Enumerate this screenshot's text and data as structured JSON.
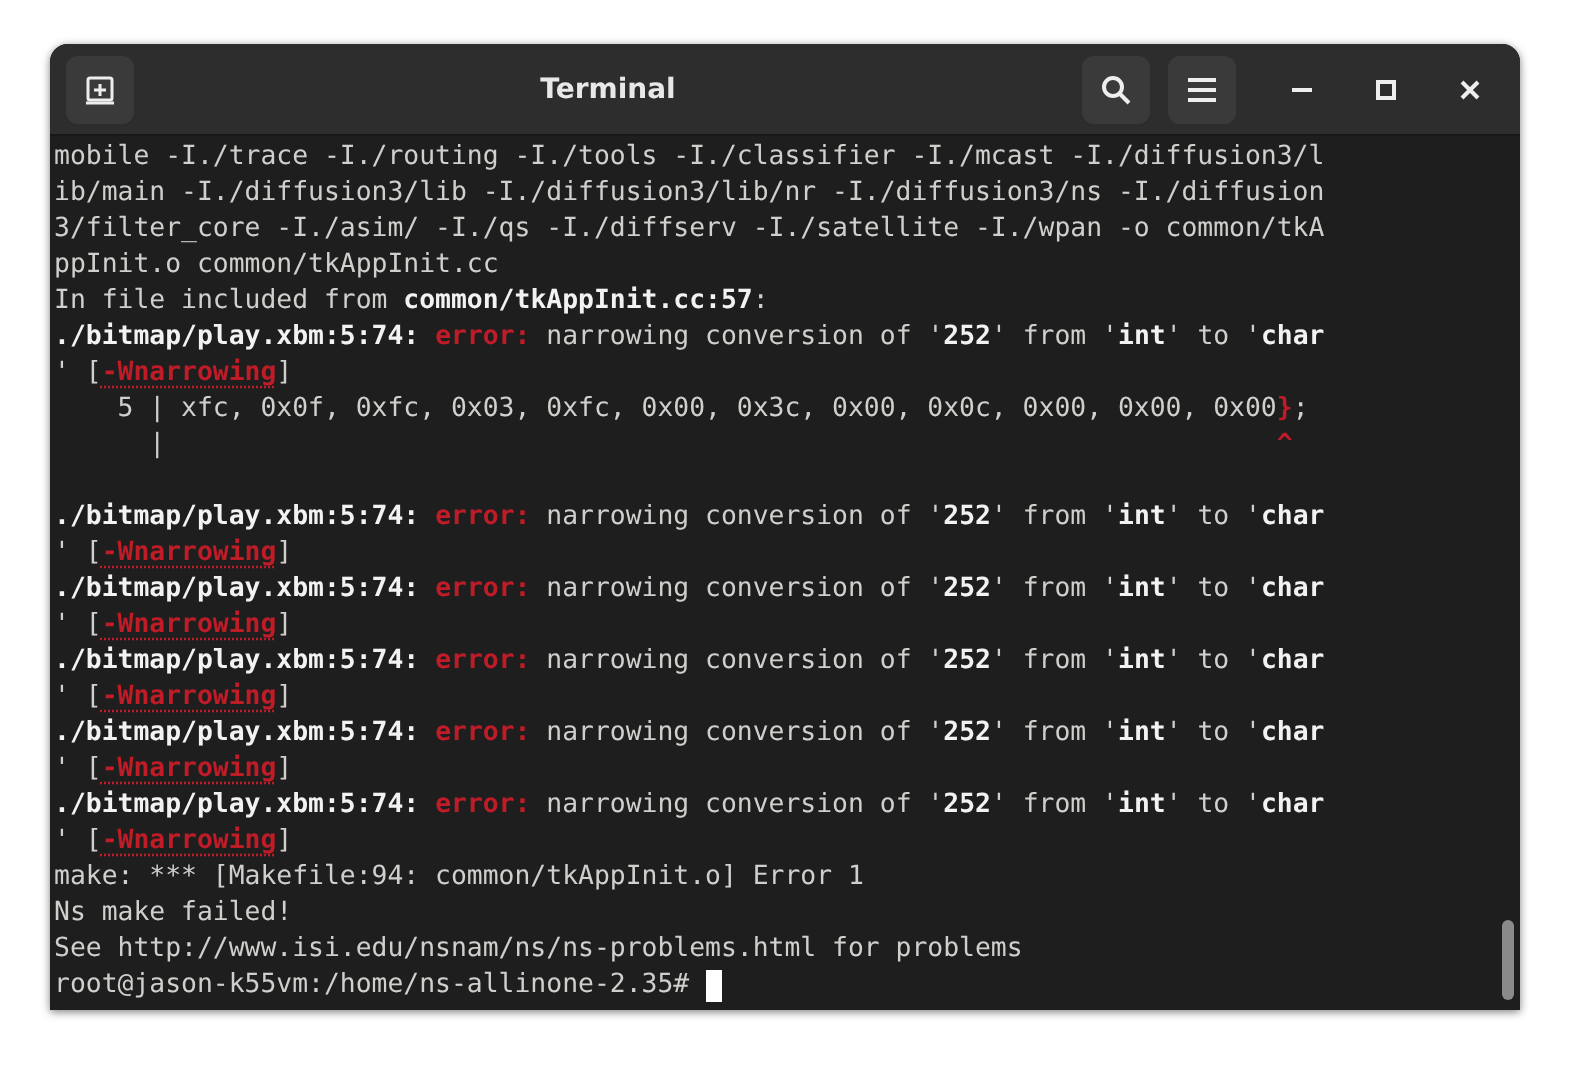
{
  "window": {
    "title": "Terminal"
  },
  "terminal": {
    "cursor": true,
    "lines": [
      {
        "kind": "text",
        "segments": [
          {
            "kind": "plain",
            "text": "mobile -I./trace -I./routing -I./tools -I./classifier -I./mcast -I./diffusion3/l"
          }
        ]
      },
      {
        "kind": "text",
        "segments": [
          {
            "kind": "plain",
            "text": "ib/main -I./diffusion3/lib -I./diffusion3/lib/nr -I./diffusion3/ns -I./diffusion"
          }
        ]
      },
      {
        "kind": "text",
        "segments": [
          {
            "kind": "plain",
            "text": "3/filter_core -I./asim/ -I./qs -I./diffserv -I./satellite -I./wpan -o common/tkA"
          }
        ]
      },
      {
        "kind": "text",
        "segments": [
          {
            "kind": "plain",
            "text": "ppInit.o common/tkAppInit.cc"
          }
        ]
      },
      {
        "kind": "text",
        "segments": [
          {
            "kind": "plain",
            "text": "In file included from "
          },
          {
            "kind": "bold",
            "text": "common/tkAppInit.cc:57"
          },
          {
            "kind": "plain",
            "text": ":"
          }
        ]
      },
      {
        "kind": "text",
        "segments": [
          {
            "kind": "bold",
            "text": "./bitmap/play.xbm:5:74:"
          },
          {
            "kind": "error",
            "text": " error:"
          },
          {
            "kind": "plain",
            "text": " narrowing conversion of '"
          },
          {
            "kind": "bold",
            "text": "252"
          },
          {
            "kind": "plain",
            "text": "' from '"
          },
          {
            "kind": "bold",
            "text": "int"
          },
          {
            "kind": "plain",
            "text": "' to '"
          },
          {
            "kind": "bold",
            "text": "char"
          }
        ]
      },
      {
        "kind": "text",
        "segments": [
          {
            "kind": "plain",
            "text": "' ["
          },
          {
            "kind": "flag",
            "text": "-Wnarrowing"
          },
          {
            "kind": "plain",
            "text": "]"
          }
        ]
      },
      {
        "kind": "text",
        "segments": [
          {
            "kind": "plain",
            "text": "    5 | xfc, 0x0f, 0xfc, 0x03, 0xfc, 0x00, 0x3c, 0x00, 0x0c, 0x00, 0x00, 0x00"
          },
          {
            "kind": "mark",
            "text": "}"
          },
          {
            "kind": "plain",
            "text": ";"
          }
        ]
      },
      {
        "kind": "text",
        "segments": [
          {
            "kind": "plain",
            "text": "      |                                                                      "
          },
          {
            "kind": "mark",
            "text": "^"
          }
        ]
      },
      {
        "kind": "blank"
      },
      {
        "kind": "text",
        "segments": [
          {
            "kind": "bold",
            "text": "./bitmap/play.xbm:5:74:"
          },
          {
            "kind": "error",
            "text": " error:"
          },
          {
            "kind": "plain",
            "text": " narrowing conversion of '"
          },
          {
            "kind": "bold",
            "text": "252"
          },
          {
            "kind": "plain",
            "text": "' from '"
          },
          {
            "kind": "bold",
            "text": "int"
          },
          {
            "kind": "plain",
            "text": "' to '"
          },
          {
            "kind": "bold",
            "text": "char"
          }
        ]
      },
      {
        "kind": "text",
        "segments": [
          {
            "kind": "plain",
            "text": "' ["
          },
          {
            "kind": "flag",
            "text": "-Wnarrowing"
          },
          {
            "kind": "plain",
            "text": "]"
          }
        ]
      },
      {
        "kind": "text",
        "segments": [
          {
            "kind": "bold",
            "text": "./bitmap/play.xbm:5:74:"
          },
          {
            "kind": "error",
            "text": " error:"
          },
          {
            "kind": "plain",
            "text": " narrowing conversion of '"
          },
          {
            "kind": "bold",
            "text": "252"
          },
          {
            "kind": "plain",
            "text": "' from '"
          },
          {
            "kind": "bold",
            "text": "int"
          },
          {
            "kind": "plain",
            "text": "' to '"
          },
          {
            "kind": "bold",
            "text": "char"
          }
        ]
      },
      {
        "kind": "text",
        "segments": [
          {
            "kind": "plain",
            "text": "' ["
          },
          {
            "kind": "flag",
            "text": "-Wnarrowing"
          },
          {
            "kind": "plain",
            "text": "]"
          }
        ]
      },
      {
        "kind": "text",
        "segments": [
          {
            "kind": "bold",
            "text": "./bitmap/play.xbm:5:74:"
          },
          {
            "kind": "error",
            "text": " error:"
          },
          {
            "kind": "plain",
            "text": " narrowing conversion of '"
          },
          {
            "kind": "bold",
            "text": "252"
          },
          {
            "kind": "plain",
            "text": "' from '"
          },
          {
            "kind": "bold",
            "text": "int"
          },
          {
            "kind": "plain",
            "text": "' to '"
          },
          {
            "kind": "bold",
            "text": "char"
          }
        ]
      },
      {
        "kind": "text",
        "segments": [
          {
            "kind": "plain",
            "text": "' ["
          },
          {
            "kind": "flag",
            "text": "-Wnarrowing"
          },
          {
            "kind": "plain",
            "text": "]"
          }
        ]
      },
      {
        "kind": "text",
        "segments": [
          {
            "kind": "bold",
            "text": "./bitmap/play.xbm:5:74:"
          },
          {
            "kind": "error",
            "text": " error:"
          },
          {
            "kind": "plain",
            "text": " narrowing conversion of '"
          },
          {
            "kind": "bold",
            "text": "252"
          },
          {
            "kind": "plain",
            "text": "' from '"
          },
          {
            "kind": "bold",
            "text": "int"
          },
          {
            "kind": "plain",
            "text": "' to '"
          },
          {
            "kind": "bold",
            "text": "char"
          }
        ]
      },
      {
        "kind": "text",
        "segments": [
          {
            "kind": "plain",
            "text": "' ["
          },
          {
            "kind": "flag",
            "text": "-Wnarrowing"
          },
          {
            "kind": "plain",
            "text": "]"
          }
        ]
      },
      {
        "kind": "text",
        "segments": [
          {
            "kind": "bold",
            "text": "./bitmap/play.xbm:5:74:"
          },
          {
            "kind": "error",
            "text": " error:"
          },
          {
            "kind": "plain",
            "text": " narrowing conversion of '"
          },
          {
            "kind": "bold",
            "text": "252"
          },
          {
            "kind": "plain",
            "text": "' from '"
          },
          {
            "kind": "bold",
            "text": "int"
          },
          {
            "kind": "plain",
            "text": "' to '"
          },
          {
            "kind": "bold",
            "text": "char"
          }
        ]
      },
      {
        "kind": "text",
        "segments": [
          {
            "kind": "plain",
            "text": "' ["
          },
          {
            "kind": "flag",
            "text": "-Wnarrowing"
          },
          {
            "kind": "plain",
            "text": "]"
          }
        ]
      },
      {
        "kind": "text",
        "segments": [
          {
            "kind": "plain",
            "text": "make: *** [Makefile:94: common/tkAppInit.o] Error 1"
          }
        ]
      },
      {
        "kind": "text",
        "segments": [
          {
            "kind": "plain",
            "text": "Ns make failed!"
          }
        ]
      },
      {
        "kind": "text",
        "segments": [
          {
            "kind": "plain",
            "text": "See http://www.isi.edu/nsnam/ns/ns-problems.html for problems"
          }
        ]
      },
      {
        "kind": "prompt",
        "segments": [
          {
            "kind": "plain",
            "text": "root@jason-k55vm:/home/ns-allinone-2.35# "
          }
        ]
      }
    ]
  }
}
